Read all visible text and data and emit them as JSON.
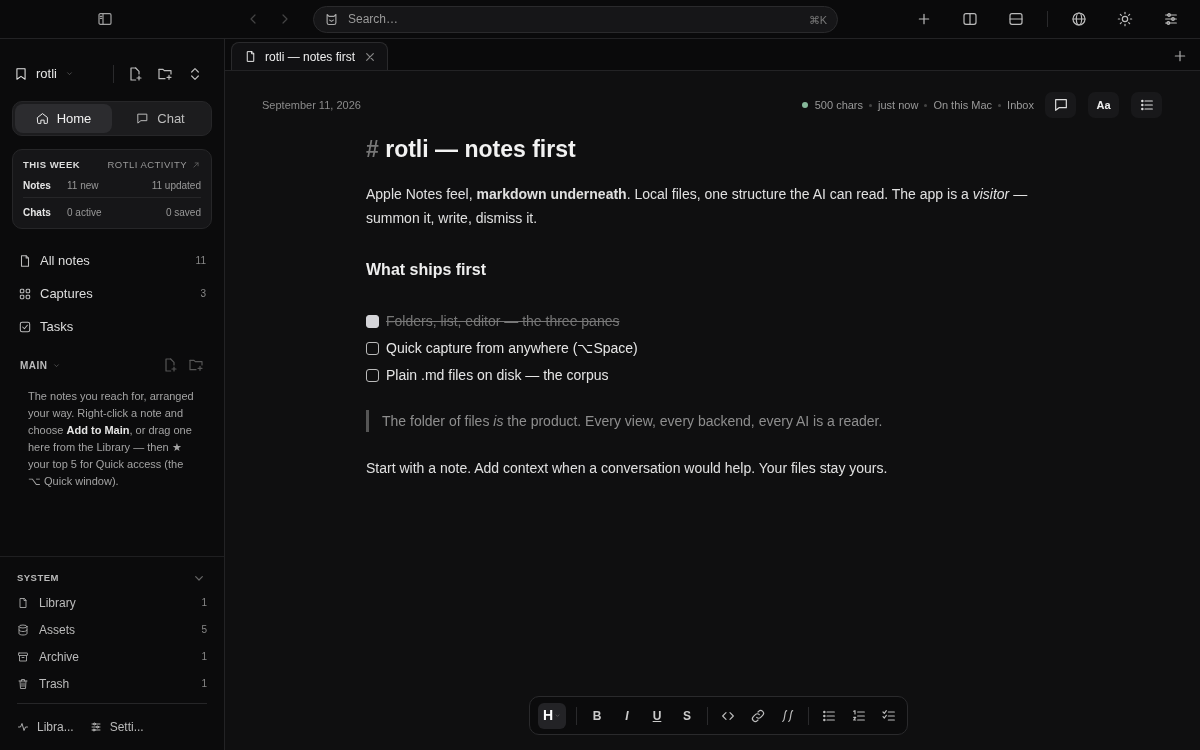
{
  "topbar": {
    "search": {
      "placeholder": "Search…",
      "shortcut": "⌘K"
    }
  },
  "sidebar": {
    "workspace": "rotli",
    "segments": [
      {
        "label": "Home",
        "selected": true
      },
      {
        "label": "Chat",
        "selected": false
      }
    ],
    "activity": {
      "title": "THIS WEEK",
      "link": "ROTLI ACTIVITY",
      "rows": [
        {
          "label": "Notes",
          "first": "11 new",
          "second": "11 updated"
        },
        {
          "label": "Chats",
          "first": "0 active",
          "second": "0 saved"
        }
      ]
    },
    "nav": [
      {
        "label": "All notes",
        "count": "11"
      },
      {
        "label": "Captures",
        "count": "3"
      },
      {
        "label": "Tasks"
      }
    ],
    "main": {
      "title": "MAIN",
      "description": "The notes you reach for, arranged your way. Right-click a note and choose **Add to Main**, or drag one here from the Library — then ★ your top 5 for Quick access (the ⌥ Quick window)."
    },
    "system": {
      "title": "SYSTEM",
      "items": [
        {
          "label": "Library",
          "count": "1"
        },
        {
          "label": "Assets",
          "count": "5"
        },
        {
          "label": "Archive",
          "count": "1"
        },
        {
          "label": "Trash",
          "count": "1"
        }
      ]
    },
    "footer": [
      {
        "label": "Libra..."
      },
      {
        "label": "Setti..."
      }
    ]
  },
  "tabs": [
    {
      "title": "rotli — notes first",
      "selected": true
    }
  ],
  "editor": {
    "date": "September 11, 2026",
    "status": [
      "500 chars",
      "just now",
      "On this Mac",
      "Inbox"
    ],
    "font_button": "Aa",
    "heading_mark": "#",
    "heading": "rotli — notes first",
    "intro": "Apple Notes feel, **markdown underneath**. Local files, one structure the AI can read. The app is a *visitor* — summon it, write, dismiss it.",
    "subheading": "What ships first",
    "tasks": [
      {
        "text": "Folders, list, editor — the three panes",
        "checked": true
      },
      {
        "text": "Quick capture from anywhere (⌥Space)",
        "checked": false
      },
      {
        "text": "Plain .md files on disk — the corpus",
        "checked": false
      }
    ],
    "quote": "The folder of files *is* the product. Every view, every backend, every AI is a reader.",
    "closing": "Start with a note. Add context when a conversation would help. Your files stay yours."
  },
  "format_toolbar": [
    {
      "kind": "heading",
      "label": "H"
    },
    {
      "kind": "divider"
    },
    {
      "kind": "bold",
      "label": "B"
    },
    {
      "kind": "italic",
      "label": "I"
    },
    {
      "kind": "underline",
      "label": "U"
    },
    {
      "kind": "strike",
      "label": "S"
    },
    {
      "kind": "divider"
    },
    {
      "kind": "code"
    },
    {
      "kind": "link"
    },
    {
      "kind": "math"
    },
    {
      "kind": "divider"
    },
    {
      "kind": "bullets"
    },
    {
      "kind": "numbers"
    },
    {
      "kind": "checklist"
    }
  ]
}
